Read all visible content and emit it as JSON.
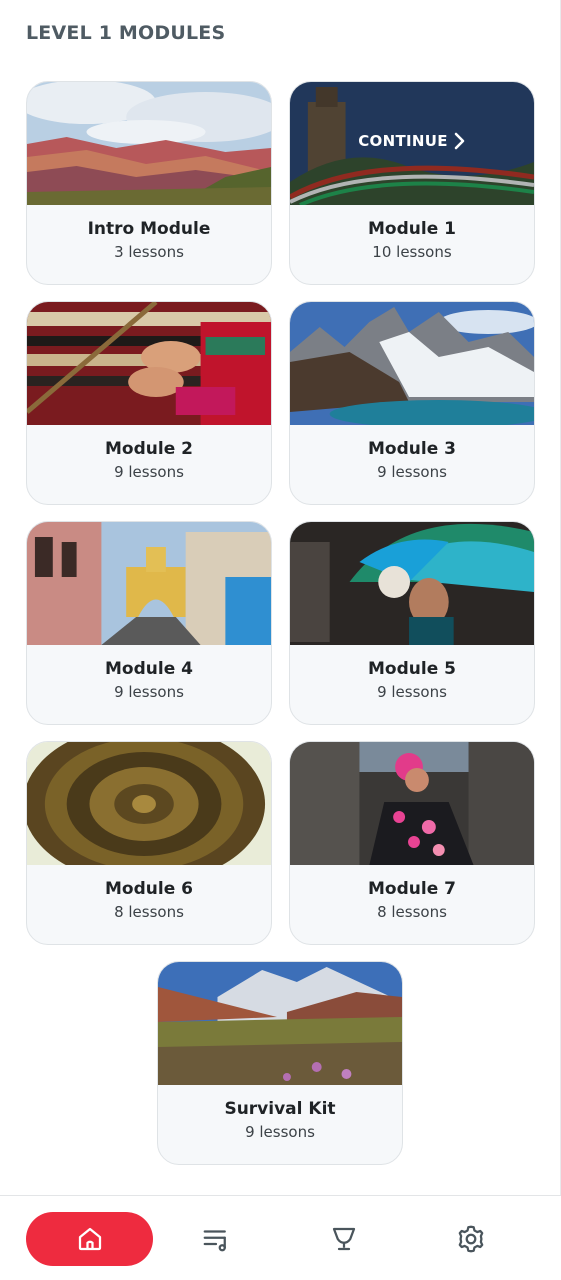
{
  "header": {
    "title": "LEVEL 1 MODULES"
  },
  "modules": [
    {
      "title": "Intro Module",
      "lessons": "3 lessons"
    },
    {
      "title": "Module 1",
      "lessons": "10 lessons",
      "overlay": "CONTINUE"
    },
    {
      "title": "Module 2",
      "lessons": "9 lessons"
    },
    {
      "title": "Module 3",
      "lessons": "9 lessons"
    },
    {
      "title": "Module 4",
      "lessons": "9 lessons"
    },
    {
      "title": "Module 5",
      "lessons": "9 lessons"
    },
    {
      "title": "Module 6",
      "lessons": "8 lessons"
    },
    {
      "title": "Module 7",
      "lessons": "8 lessons"
    },
    {
      "title": "Survival Kit",
      "lessons": "9 lessons"
    }
  ],
  "bottom_nav": {
    "items": [
      "home-icon",
      "playlist-icon",
      "trophy-icon",
      "settings-icon"
    ],
    "active": "home-icon"
  },
  "colors": {
    "accent": "#ee2b3f",
    "heading": "#4f5b63",
    "icon": "#4a555c",
    "card_bg": "#f6f8fa"
  }
}
